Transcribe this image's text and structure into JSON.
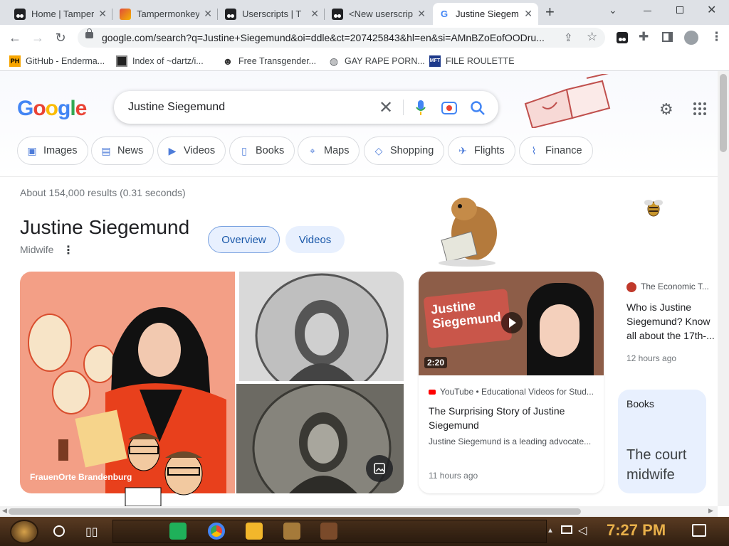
{
  "tabs": [
    {
      "title": "Home | Tamper",
      "icon": "tampermonkey-icon"
    },
    {
      "title": "Tampermonkey",
      "icon": "tampermonkey-icon"
    },
    {
      "title": "Userscripts | T",
      "icon": "tampermonkey-icon"
    },
    {
      "title": "<New userscrip",
      "icon": "tampermonkey-icon"
    },
    {
      "title": "Justine Siegem",
      "icon": "google-icon"
    }
  ],
  "address": {
    "url": "google.com/search?q=Justine+Siegemund&oi=ddle&ct=207425843&hl=en&si=AMnBZoEofOODru..."
  },
  "bookmarks": [
    {
      "label": "GitHub - Enderma...",
      "icon": "PH"
    },
    {
      "label": "Index of ~dartz/i...",
      "icon": "grid-icon"
    },
    {
      "label": "Free Transgender...",
      "icon": "mask-icon"
    },
    {
      "label": "GAY RAPE PORN...",
      "icon": "globe-icon"
    },
    {
      "label": "FILE ROULETTE",
      "icon": "MFT"
    }
  ],
  "search": {
    "query": "Justine Siegemund",
    "logo": "Google"
  },
  "filters": [
    "Images",
    "News",
    "Videos",
    "Books",
    "Maps",
    "Shopping",
    "Flights",
    "Finance"
  ],
  "results_stats": "About 154,000 results (0.31 seconds)",
  "knowledge_panel": {
    "title": "Justine Siegemund",
    "subtitle": "Midwife",
    "tabs": [
      "Overview",
      "Videos"
    ],
    "image_caption": "FrauenOrte Brandenburg"
  },
  "video_card": {
    "duration": "2:20",
    "source": "YouTube • Educational Videos for Stud...",
    "title": "The Surprising Story of Justine Siegemund",
    "description": "Justine Siegemund is a leading advocate...",
    "time": "11 hours ago",
    "thumb_text": "Justine Siegemund"
  },
  "news_card": {
    "source": "The Economic T...",
    "title": "Who is Justine Siegemund? Know all about the 17th-...",
    "time": "12 hours ago"
  },
  "books_card": {
    "heading": "Books",
    "title": "The court midwife"
  },
  "taskbar": {
    "clock": "7:27 PM"
  },
  "colors": {
    "accent": "#1a73e8",
    "chip_border": "#dadce0",
    "pill_bg": "#e8f0fe",
    "taskbar": "#3b2616",
    "clock": "#e8b04a"
  }
}
